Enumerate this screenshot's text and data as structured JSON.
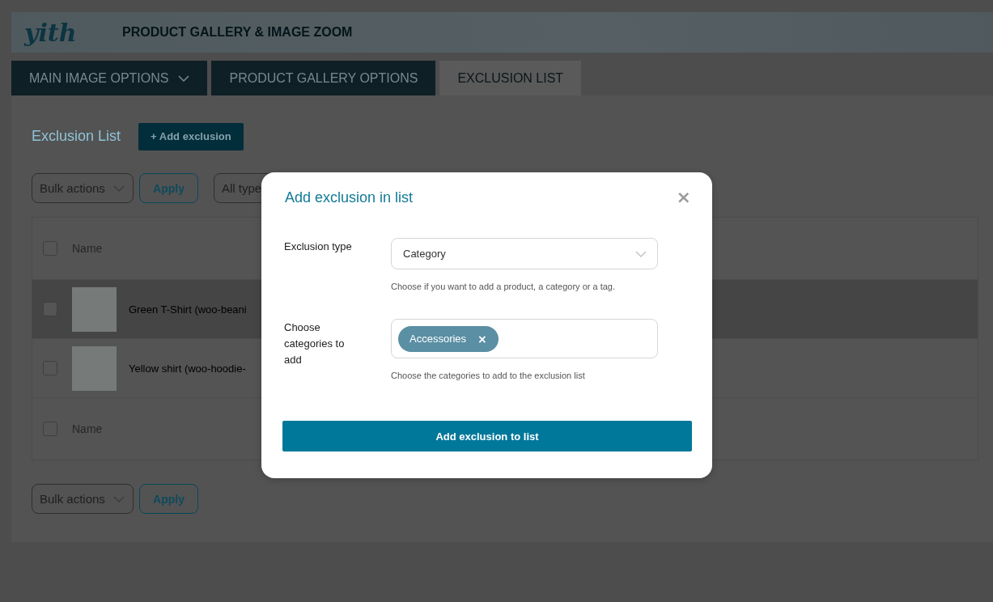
{
  "header": {
    "logo": "yith",
    "title": "PRODUCT GALLERY & IMAGE ZOOM"
  },
  "tabs": [
    {
      "label": "MAIN IMAGE OPTIONS",
      "selected": false,
      "has_dropdown": true
    },
    {
      "label": "PRODUCT GALLERY OPTIONS",
      "selected": false,
      "has_dropdown": false
    },
    {
      "label": "EXCLUSION LIST",
      "selected": true,
      "has_dropdown": false
    }
  ],
  "panel": {
    "title": "Exclusion List",
    "add_button": "+ Add exclusion",
    "top_actions": {
      "bulk": "Bulk actions",
      "apply": "Apply",
      "type_filter": "All type"
    },
    "table": {
      "header": {
        "label": "Name",
        "checked": false
      },
      "rows": [
        {
          "name": "Green T-Shirt (woo-beani",
          "checked": false,
          "highlighted": true
        },
        {
          "name": "Yellow shirt (woo-hoodie-",
          "checked": false,
          "highlighted": false
        }
      ],
      "footer": {
        "label": "Name",
        "checked": false
      }
    },
    "bottom_actions": {
      "bulk": "Bulk actions",
      "apply": "Apply"
    }
  },
  "modal": {
    "title": "Add exclusion in list",
    "close": "×",
    "fields": [
      {
        "kind": "select",
        "label": "Exclusion type",
        "value": "Category",
        "help": "Choose if you want to add a product, a category or a tag."
      },
      {
        "kind": "tags",
        "label": "Choose categories to add",
        "tags": [
          {
            "label": "Accessories",
            "remove": "×"
          }
        ],
        "help": "Choose the categories to add to the exclusion list"
      }
    ],
    "submit": "Add exclusion to list"
  }
}
